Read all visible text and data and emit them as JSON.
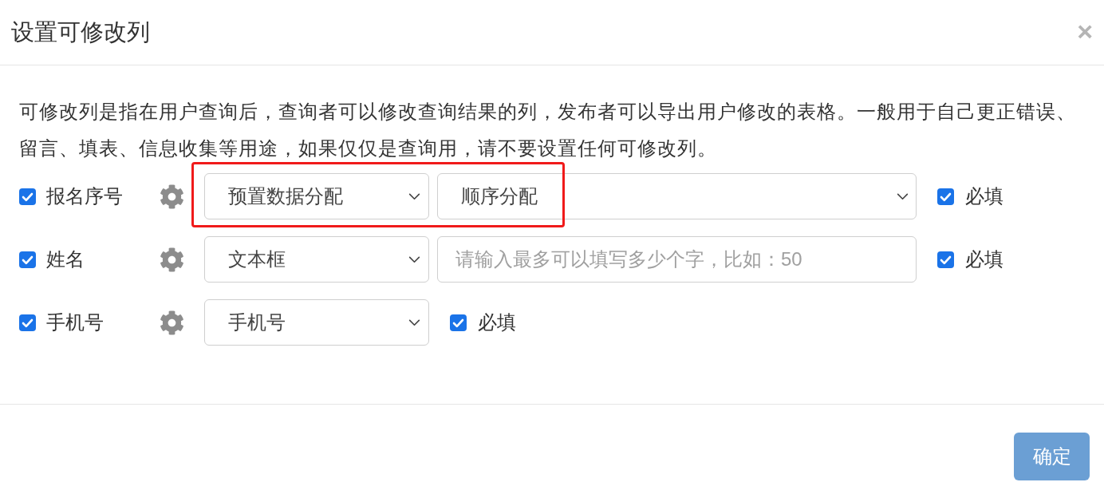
{
  "dialog": {
    "title": "设置可修改列",
    "close": "×"
  },
  "description": "可修改列是指在用户查询后，查询者可以修改查询结果的列，发布者可以导出用户修改的表格。一般用于自己更正错误、留言、填表、信息收集等用途，如果仅仅是查询用，请不要设置任何可修改列。",
  "columns": [
    {
      "label": "报名序号",
      "checked": true,
      "type": "预置数据分配",
      "option": {
        "kind": "select",
        "value": "顺序分配"
      },
      "required": {
        "label": "必填",
        "checked": true
      },
      "highlighted": true
    },
    {
      "label": "姓名",
      "checked": true,
      "type": "文本框",
      "option": {
        "kind": "input",
        "placeholder": "请输入最多可以填写多少个字，比如：50"
      },
      "required": {
        "label": "必填",
        "checked": true
      },
      "highlighted": false
    },
    {
      "label": "手机号",
      "checked": true,
      "type": "手机号",
      "required": {
        "label": "必填",
        "checked": true
      },
      "highlighted": false
    }
  ],
  "buttons": [
    {
      "label": "确定"
    }
  ]
}
